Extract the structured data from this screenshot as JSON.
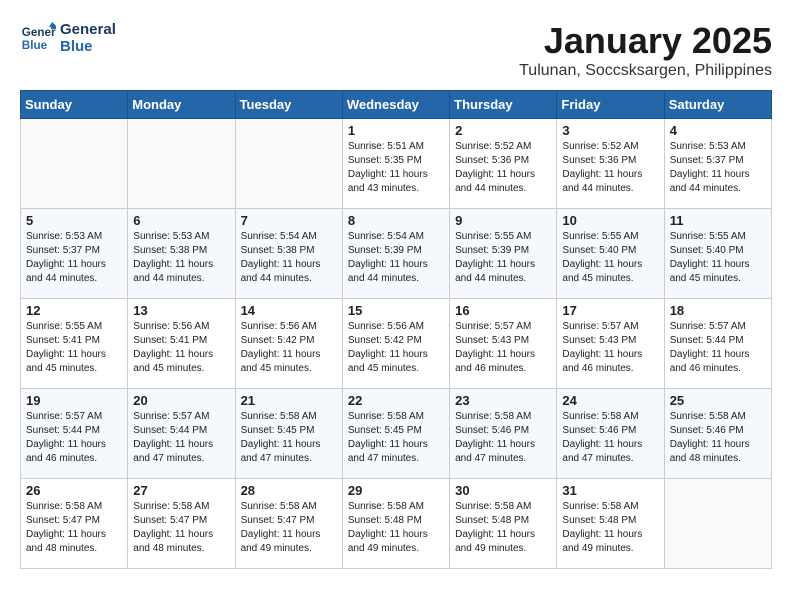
{
  "header": {
    "logo_line1": "General",
    "logo_line2": "Blue",
    "month": "January 2025",
    "location": "Tulunan, Soccsksargen, Philippines"
  },
  "weekdays": [
    "Sunday",
    "Monday",
    "Tuesday",
    "Wednesday",
    "Thursday",
    "Friday",
    "Saturday"
  ],
  "weeks": [
    [
      {
        "day": "",
        "info": ""
      },
      {
        "day": "",
        "info": ""
      },
      {
        "day": "",
        "info": ""
      },
      {
        "day": "1",
        "info": "Sunrise: 5:51 AM\nSunset: 5:35 PM\nDaylight: 11 hours\nand 43 minutes."
      },
      {
        "day": "2",
        "info": "Sunrise: 5:52 AM\nSunset: 5:36 PM\nDaylight: 11 hours\nand 44 minutes."
      },
      {
        "day": "3",
        "info": "Sunrise: 5:52 AM\nSunset: 5:36 PM\nDaylight: 11 hours\nand 44 minutes."
      },
      {
        "day": "4",
        "info": "Sunrise: 5:53 AM\nSunset: 5:37 PM\nDaylight: 11 hours\nand 44 minutes."
      }
    ],
    [
      {
        "day": "5",
        "info": "Sunrise: 5:53 AM\nSunset: 5:37 PM\nDaylight: 11 hours\nand 44 minutes."
      },
      {
        "day": "6",
        "info": "Sunrise: 5:53 AM\nSunset: 5:38 PM\nDaylight: 11 hours\nand 44 minutes."
      },
      {
        "day": "7",
        "info": "Sunrise: 5:54 AM\nSunset: 5:38 PM\nDaylight: 11 hours\nand 44 minutes."
      },
      {
        "day": "8",
        "info": "Sunrise: 5:54 AM\nSunset: 5:39 PM\nDaylight: 11 hours\nand 44 minutes."
      },
      {
        "day": "9",
        "info": "Sunrise: 5:55 AM\nSunset: 5:39 PM\nDaylight: 11 hours\nand 44 minutes."
      },
      {
        "day": "10",
        "info": "Sunrise: 5:55 AM\nSunset: 5:40 PM\nDaylight: 11 hours\nand 45 minutes."
      },
      {
        "day": "11",
        "info": "Sunrise: 5:55 AM\nSunset: 5:40 PM\nDaylight: 11 hours\nand 45 minutes."
      }
    ],
    [
      {
        "day": "12",
        "info": "Sunrise: 5:55 AM\nSunset: 5:41 PM\nDaylight: 11 hours\nand 45 minutes."
      },
      {
        "day": "13",
        "info": "Sunrise: 5:56 AM\nSunset: 5:41 PM\nDaylight: 11 hours\nand 45 minutes."
      },
      {
        "day": "14",
        "info": "Sunrise: 5:56 AM\nSunset: 5:42 PM\nDaylight: 11 hours\nand 45 minutes."
      },
      {
        "day": "15",
        "info": "Sunrise: 5:56 AM\nSunset: 5:42 PM\nDaylight: 11 hours\nand 45 minutes."
      },
      {
        "day": "16",
        "info": "Sunrise: 5:57 AM\nSunset: 5:43 PM\nDaylight: 11 hours\nand 46 minutes."
      },
      {
        "day": "17",
        "info": "Sunrise: 5:57 AM\nSunset: 5:43 PM\nDaylight: 11 hours\nand 46 minutes."
      },
      {
        "day": "18",
        "info": "Sunrise: 5:57 AM\nSunset: 5:44 PM\nDaylight: 11 hours\nand 46 minutes."
      }
    ],
    [
      {
        "day": "19",
        "info": "Sunrise: 5:57 AM\nSunset: 5:44 PM\nDaylight: 11 hours\nand 46 minutes."
      },
      {
        "day": "20",
        "info": "Sunrise: 5:57 AM\nSunset: 5:44 PM\nDaylight: 11 hours\nand 47 minutes."
      },
      {
        "day": "21",
        "info": "Sunrise: 5:58 AM\nSunset: 5:45 PM\nDaylight: 11 hours\nand 47 minutes."
      },
      {
        "day": "22",
        "info": "Sunrise: 5:58 AM\nSunset: 5:45 PM\nDaylight: 11 hours\nand 47 minutes."
      },
      {
        "day": "23",
        "info": "Sunrise: 5:58 AM\nSunset: 5:46 PM\nDaylight: 11 hours\nand 47 minutes."
      },
      {
        "day": "24",
        "info": "Sunrise: 5:58 AM\nSunset: 5:46 PM\nDaylight: 11 hours\nand 47 minutes."
      },
      {
        "day": "25",
        "info": "Sunrise: 5:58 AM\nSunset: 5:46 PM\nDaylight: 11 hours\nand 48 minutes."
      }
    ],
    [
      {
        "day": "26",
        "info": "Sunrise: 5:58 AM\nSunset: 5:47 PM\nDaylight: 11 hours\nand 48 minutes."
      },
      {
        "day": "27",
        "info": "Sunrise: 5:58 AM\nSunset: 5:47 PM\nDaylight: 11 hours\nand 48 minutes."
      },
      {
        "day": "28",
        "info": "Sunrise: 5:58 AM\nSunset: 5:47 PM\nDaylight: 11 hours\nand 49 minutes."
      },
      {
        "day": "29",
        "info": "Sunrise: 5:58 AM\nSunset: 5:48 PM\nDaylight: 11 hours\nand 49 minutes."
      },
      {
        "day": "30",
        "info": "Sunrise: 5:58 AM\nSunset: 5:48 PM\nDaylight: 11 hours\nand 49 minutes."
      },
      {
        "day": "31",
        "info": "Sunrise: 5:58 AM\nSunset: 5:48 PM\nDaylight: 11 hours\nand 49 minutes."
      },
      {
        "day": "",
        "info": ""
      }
    ]
  ]
}
